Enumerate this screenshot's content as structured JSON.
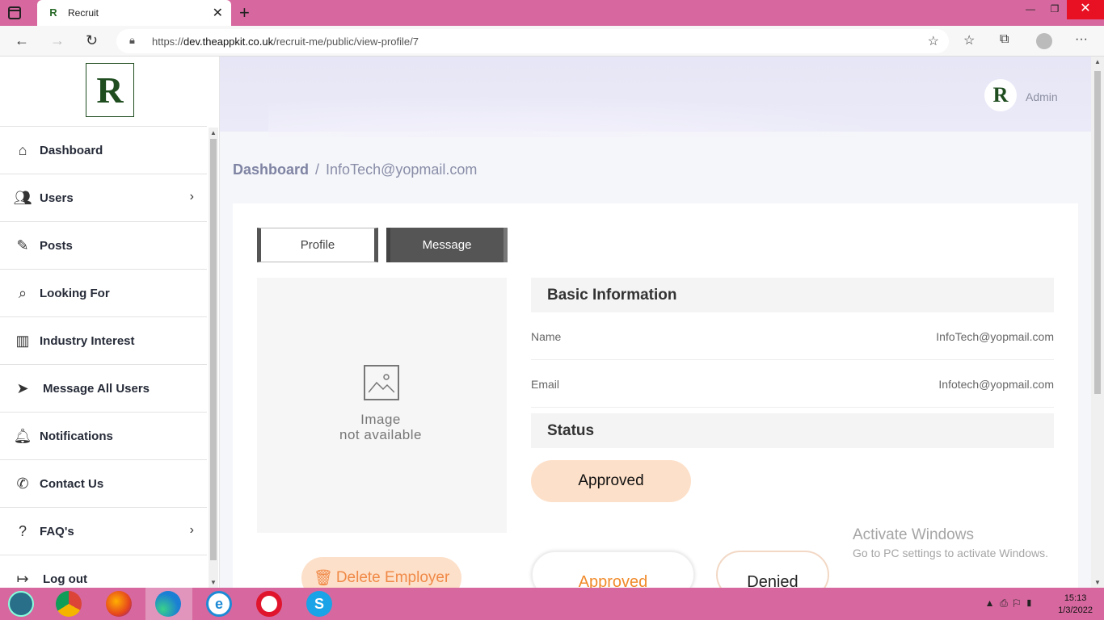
{
  "browser": {
    "tab_title": "Recruit",
    "tab_favicon": "R",
    "url_host": "dev.theappkit.co.uk",
    "url_path": "/recruit-me/public/view-profile/7",
    "url_scheme": "https://"
  },
  "sidebar": {
    "logo_letter": "R",
    "items": [
      {
        "label": "Dashboard",
        "icon": "home-icon",
        "has_submenu": false
      },
      {
        "label": "Users",
        "icon": "users-icon",
        "has_submenu": true
      },
      {
        "label": "Posts",
        "icon": "posts-icon",
        "has_submenu": false
      },
      {
        "label": "Looking For",
        "icon": "search-icon",
        "has_submenu": false
      },
      {
        "label": "Industry Interest",
        "icon": "factory-icon",
        "has_submenu": false
      },
      {
        "label": "Message All Users",
        "icon": "send-icon",
        "has_submenu": false
      },
      {
        "label": "Notifications",
        "icon": "bell-icon",
        "has_submenu": false
      },
      {
        "label": "Contact Us",
        "icon": "phone-icon",
        "has_submenu": false
      },
      {
        "label": "FAQ's",
        "icon": "faq-icon",
        "has_submenu": true
      },
      {
        "label": "Log out",
        "icon": "logout-icon",
        "has_submenu": false
      }
    ]
  },
  "header": {
    "admin_label": "Admin",
    "avatar_letter": "R"
  },
  "breadcrumb": {
    "home": "Dashboard",
    "separator": "/",
    "current": "InfoTech@yopmail.com"
  },
  "tabs": {
    "profile": "Profile",
    "message": "Message"
  },
  "profile": {
    "image_placeholder_line1": "Image",
    "image_placeholder_line2": "not available",
    "delete_button": "Delete Employer",
    "basic_info_title": "Basic Information",
    "fields": [
      {
        "label": "Name",
        "value": "InfoTech@yopmail.com"
      },
      {
        "label": "Email",
        "value": "Infotech@yopmail.com"
      }
    ],
    "status_title": "Status",
    "status_value": "Approved",
    "options": {
      "approved": "Approved",
      "denied": "Denied"
    }
  },
  "watermark": {
    "line1": "Activate Windows",
    "line2": "Go to PC settings to activate Windows."
  },
  "taskbar": {
    "time": "15:13",
    "date": "1/3/2022"
  },
  "colors": {
    "titlebar": "#d6689f",
    "accent_orange": "#f08a48",
    "pill_bg": "#fde0c9",
    "logo_green": "#1f4d1f"
  }
}
